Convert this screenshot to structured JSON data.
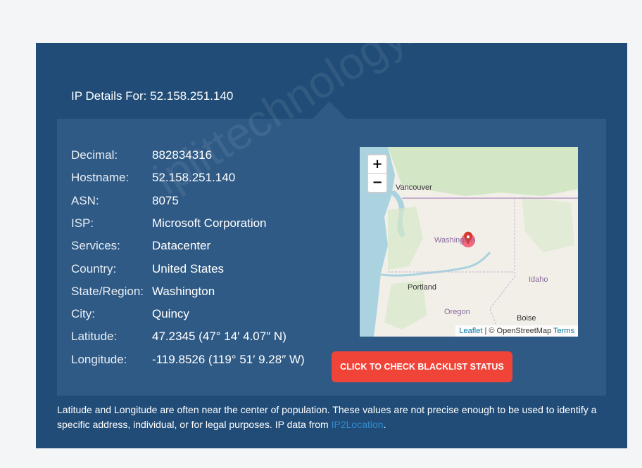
{
  "title": "IP Details For: 52.158.251.140",
  "watermark": "iplittechnology.com",
  "details": [
    {
      "key": "Decimal:",
      "value": "882834316"
    },
    {
      "key": "Hostname:",
      "value": "52.158.251.140"
    },
    {
      "key": "ASN:",
      "value": "8075"
    },
    {
      "key": "ISP:",
      "value": "Microsoft Corporation"
    },
    {
      "key": "Services:",
      "value": "Datacenter"
    },
    {
      "key": "Country:",
      "value": "United States"
    },
    {
      "key": "State/Region:",
      "value": "Washington"
    },
    {
      "key": "City:",
      "value": "Quincy"
    },
    {
      "key": "Latitude:",
      "value": "47.2345 (47° 14′ 4.07″ N)"
    },
    {
      "key": "Longitude:",
      "value": "-119.8526 (119° 51′ 9.28″ W)"
    }
  ],
  "map": {
    "zoom_in": "+",
    "zoom_out": "−",
    "labels": {
      "vancouver": "Vancouver",
      "washington": "Washington",
      "portland": "Portland",
      "idaho": "Idaho",
      "oregon": "Oregon",
      "boise": "Boise"
    },
    "attribution": {
      "leaflet": "Leaflet",
      "separator": "| © OpenStreetMap",
      "terms": "Terms"
    }
  },
  "blacklist_button": "CLICK TO CHECK BLACKLIST STATUS",
  "disclaimer": {
    "text": "Latitude and Longitude are often near the center of population. These values are not precise enough to be used to identify a specific address, individual, or for legal purposes. IP data from ",
    "source": "IP2Location",
    "end": "."
  },
  "colors": {
    "panel": "#214c77",
    "inner": "#2f5a85",
    "button": "#f04438",
    "link": "#2f8bd1"
  }
}
